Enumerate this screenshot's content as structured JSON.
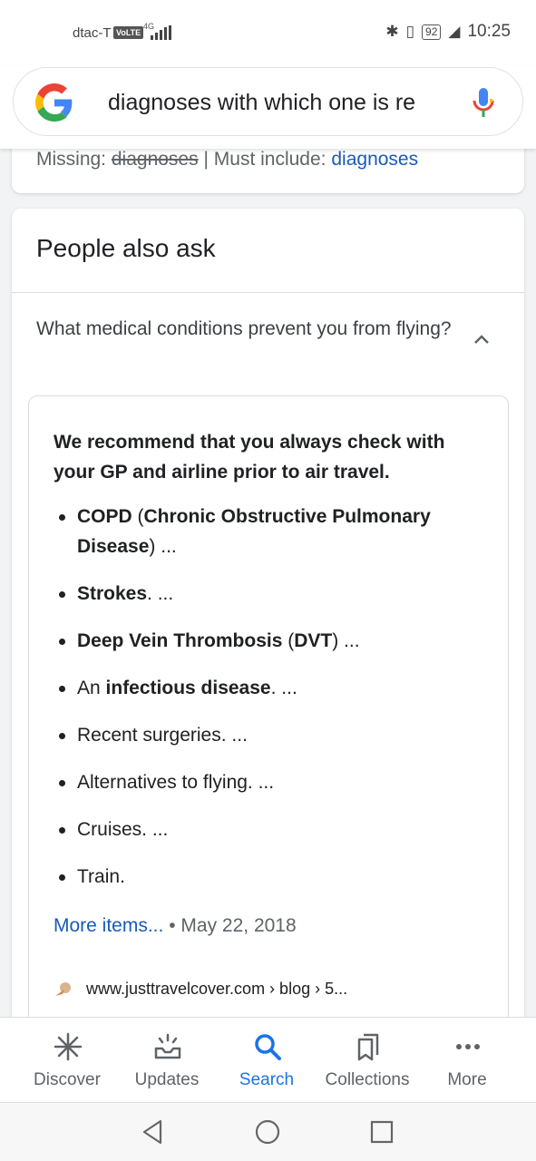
{
  "status_bar": {
    "carrier": "dtac-T",
    "volte": "VoLTE",
    "network": "4G",
    "battery": "92",
    "time": "10:25"
  },
  "search": {
    "query": "diagnoses with which one is re"
  },
  "missing_bar": {
    "missing_label": "Missing:",
    "missing_term": "diagnoses",
    "separator": "|",
    "must_include_label": "Must include:",
    "must_include_term": "diagnoses"
  },
  "people_also_ask": {
    "title": "People also ask",
    "question": "What medical conditions prevent you from flying?",
    "answer_heading": "We recommend that you always check with your GP and airline prior to air travel.",
    "items": [
      {
        "parts": [
          {
            "text": "COPD",
            "bold": true
          },
          {
            "text": " (",
            "bold": false
          },
          {
            "text": "Chronic Obstructive Pulmonary Disease",
            "bold": true
          },
          {
            "text": ") ...",
            "bold": false
          }
        ]
      },
      {
        "parts": [
          {
            "text": "Strokes",
            "bold": true
          },
          {
            "text": ". ...",
            "bold": false
          }
        ]
      },
      {
        "parts": [
          {
            "text": "Deep Vein Thrombosis",
            "bold": true
          },
          {
            "text": " (",
            "bold": false
          },
          {
            "text": "DVT",
            "bold": true
          },
          {
            "text": ") ...",
            "bold": false
          }
        ]
      },
      {
        "parts": [
          {
            "text": "An ",
            "bold": false
          },
          {
            "text": "infectious disease",
            "bold": true
          },
          {
            "text": ". ...",
            "bold": false
          }
        ]
      },
      {
        "parts": [
          {
            "text": "Recent surgeries. ...",
            "bold": false
          }
        ]
      },
      {
        "parts": [
          {
            "text": "Alternatives to flying. ...",
            "bold": false
          }
        ]
      },
      {
        "parts": [
          {
            "text": "Cruises. ...",
            "bold": false
          }
        ]
      },
      {
        "parts": [
          {
            "text": "Train.",
            "bold": false
          }
        ]
      }
    ],
    "more_items_link": "More items...",
    "dot": "•",
    "date": "May 22, 2018",
    "source_url": "www.justtravelcover.com › blog › 5..."
  },
  "bottom_nav": [
    {
      "label": "Discover",
      "icon": "asterisk-icon"
    },
    {
      "label": "Updates",
      "icon": "updates-tray-icon"
    },
    {
      "label": "Search",
      "icon": "search-icon"
    },
    {
      "label": "Collections",
      "icon": "bookmarks-icon"
    },
    {
      "label": "More",
      "icon": "more-horizontal-icon"
    }
  ],
  "colors": {
    "link": "#1a5ab8",
    "active_nav": "#1a73e8",
    "text": "#202124",
    "muted": "#5f6368"
  }
}
